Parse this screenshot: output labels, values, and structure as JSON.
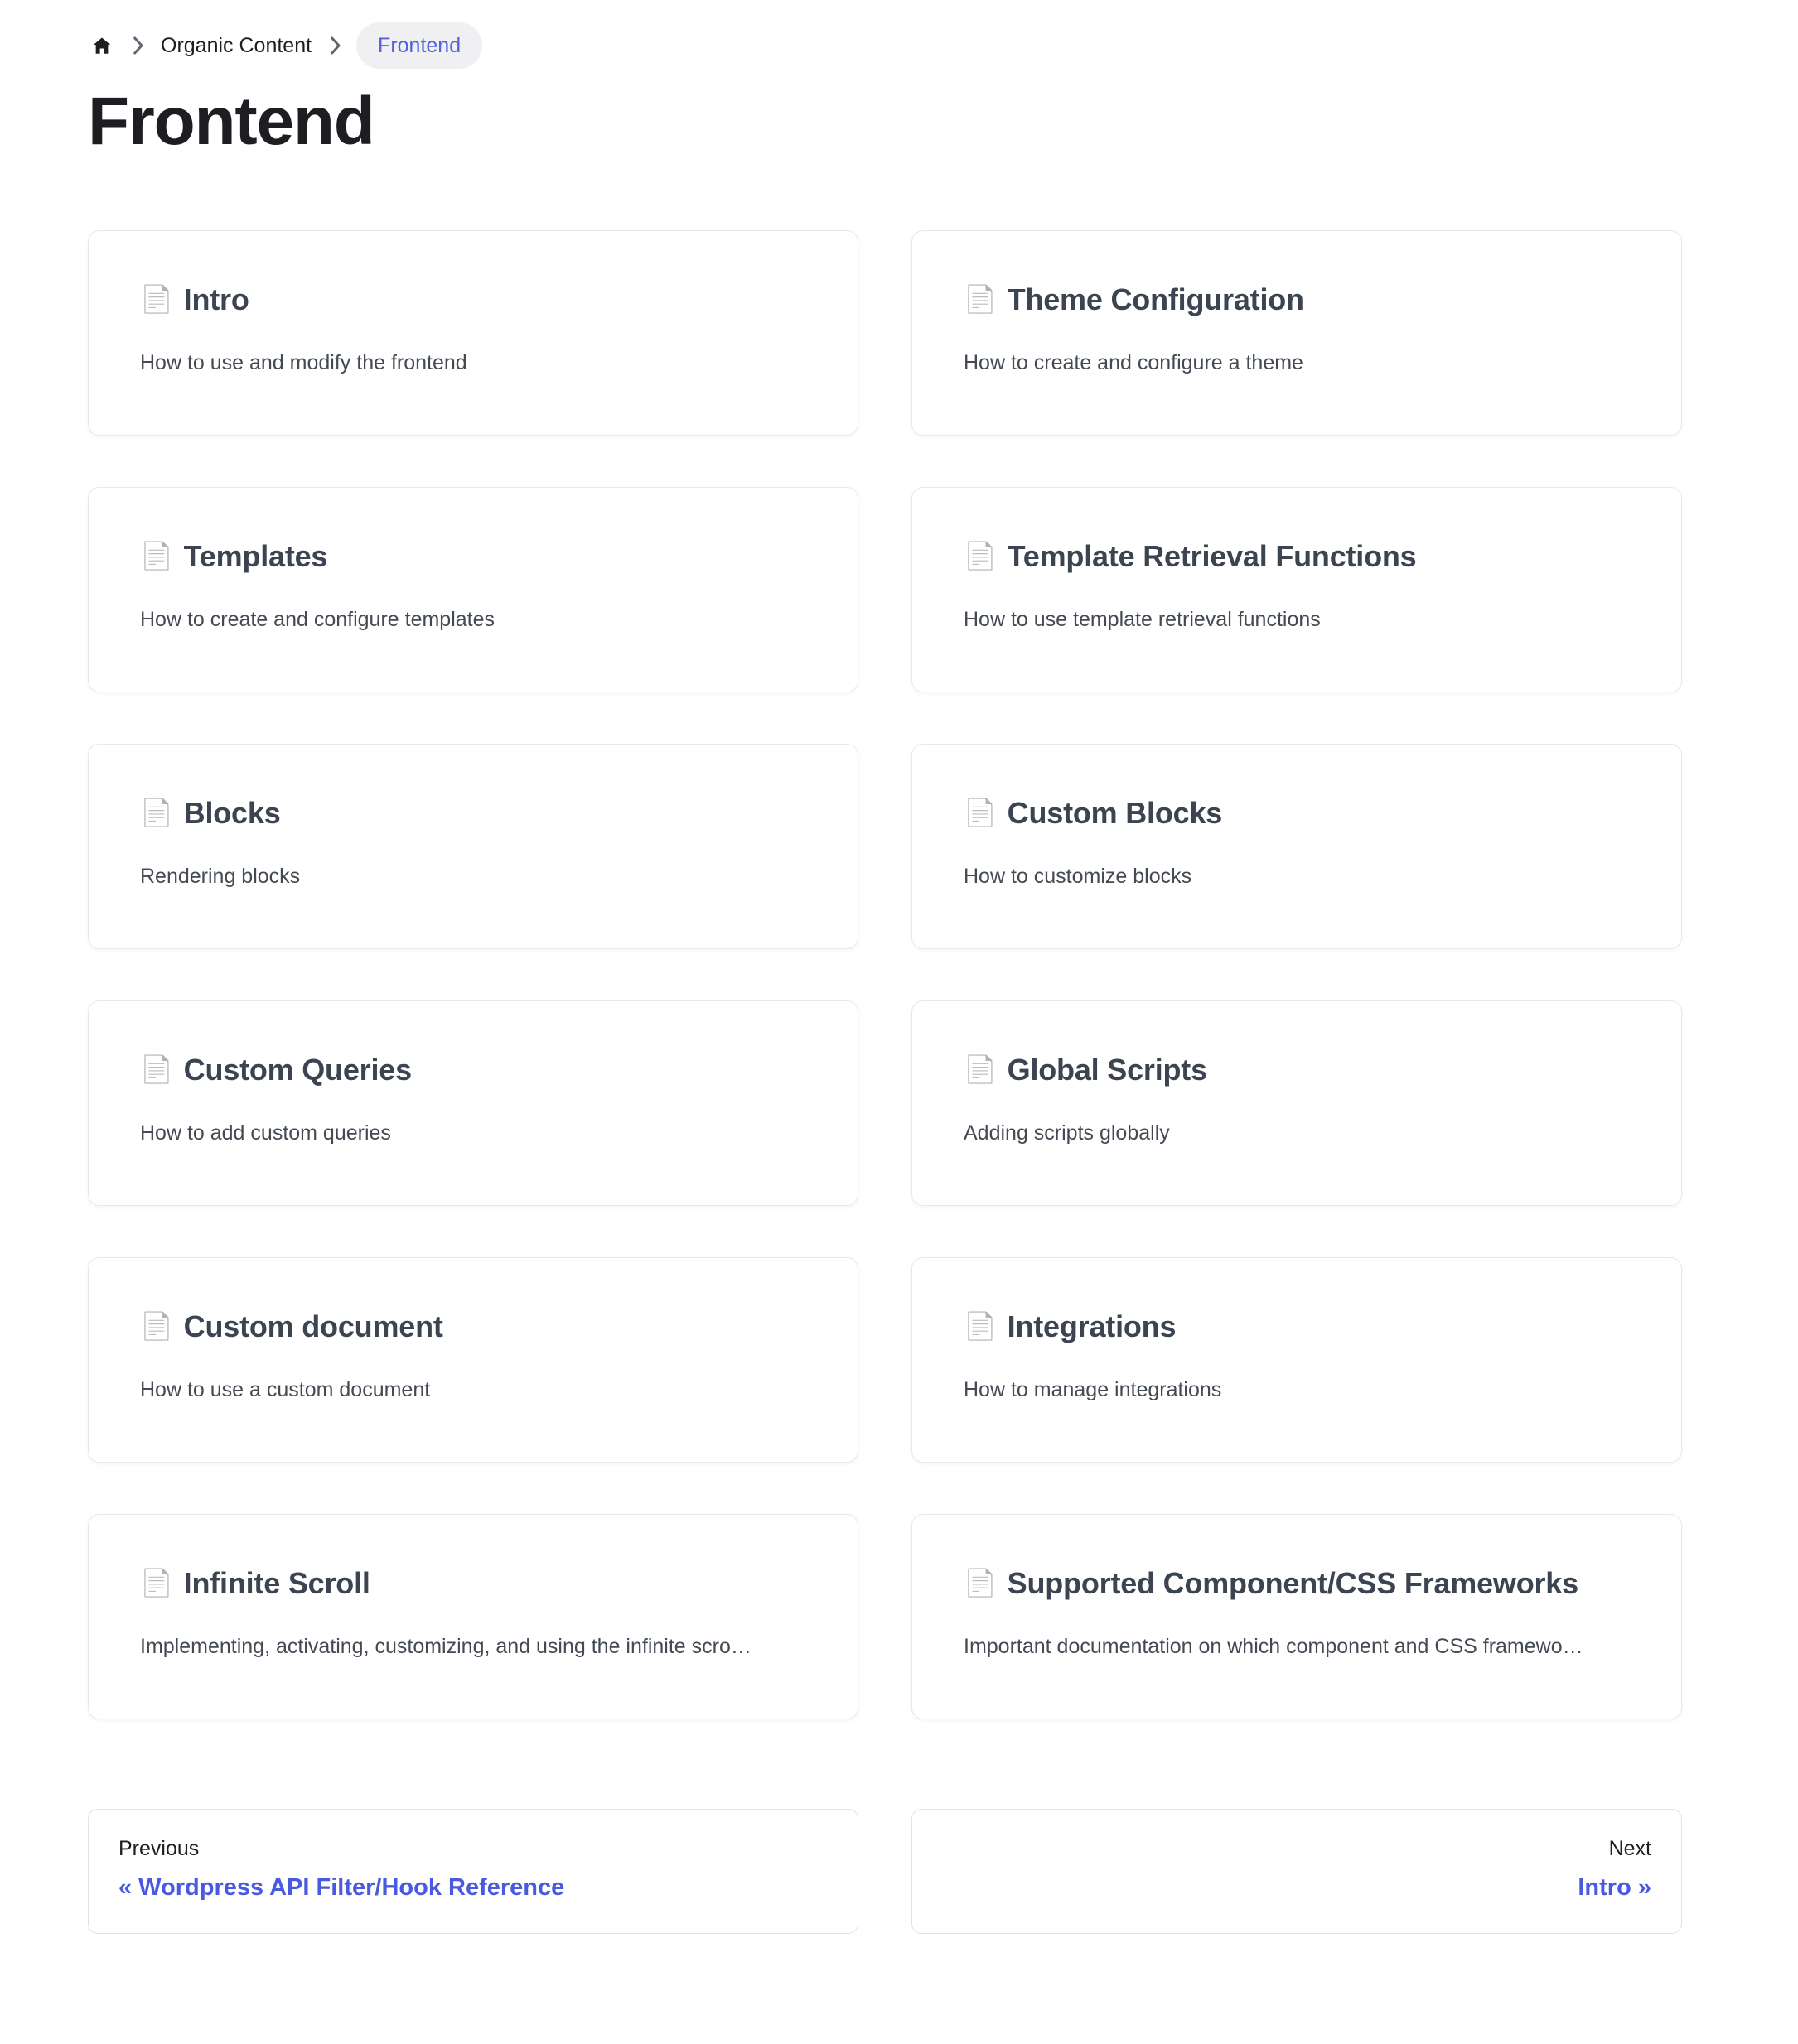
{
  "breadcrumb": {
    "home_icon": "home-icon",
    "separator_icon": "chevron-right-icon",
    "items": [
      {
        "label": "Organic Content",
        "active": false
      },
      {
        "label": "Frontend",
        "active": true
      }
    ]
  },
  "header": {
    "title": "Frontend"
  },
  "colors": {
    "link_blue": "#4a5ae0",
    "breadcrumb_active_text": "#5161e0",
    "breadcrumb_active_bg": "#f0f0f2",
    "title_dark": "#1c1e21",
    "card_title": "#3c4451",
    "card_border": "#e8e8ea"
  },
  "cards": [
    {
      "icon": "page-facing-up-icon",
      "icon_glyph": "📄",
      "title": "Intro",
      "description": "How to use and modify the frontend"
    },
    {
      "icon": "page-facing-up-icon",
      "icon_glyph": "📄",
      "title": "Theme Configuration",
      "description": "How to create and configure a theme"
    },
    {
      "icon": "page-facing-up-icon",
      "icon_glyph": "📄",
      "title": "Templates",
      "description": "How to create and configure templates"
    },
    {
      "icon": "page-facing-up-icon",
      "icon_glyph": "📄",
      "title": "Template Retrieval Functions",
      "description": "How to use template retrieval functions"
    },
    {
      "icon": "page-facing-up-icon",
      "icon_glyph": "📄",
      "title": "Blocks",
      "description": "Rendering blocks"
    },
    {
      "icon": "page-facing-up-icon",
      "icon_glyph": "📄",
      "title": "Custom Blocks",
      "description": "How to customize blocks"
    },
    {
      "icon": "page-facing-up-icon",
      "icon_glyph": "📄",
      "title": "Custom Queries",
      "description": "How to add custom queries"
    },
    {
      "icon": "page-facing-up-icon",
      "icon_glyph": "📄",
      "title": "Global Scripts",
      "description": "Adding scripts globally"
    },
    {
      "icon": "page-facing-up-icon",
      "icon_glyph": "📄",
      "title": "Custom document",
      "description": "How to use a custom document"
    },
    {
      "icon": "page-facing-up-icon",
      "icon_glyph": "📄",
      "title": "Integrations",
      "description": "How to manage integrations"
    },
    {
      "icon": "page-facing-up-icon",
      "icon_glyph": "📄",
      "title": "Infinite Scroll",
      "description": "Implementing, activating, customizing, and using the infinite scro…"
    },
    {
      "icon": "page-facing-up-icon",
      "icon_glyph": "📄",
      "title": "Supported Component/CSS Frameworks",
      "description": "Important documentation on which component and CSS framewo…"
    }
  ],
  "pagination": {
    "previous": {
      "label": "Previous",
      "title": "« Wordpress API Filter/Hook Reference"
    },
    "next": {
      "label": "Next",
      "title": "Intro »"
    }
  }
}
